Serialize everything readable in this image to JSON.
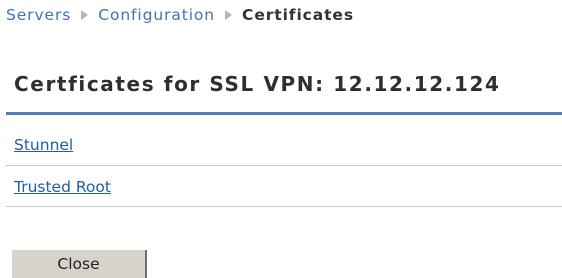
{
  "breadcrumb": {
    "items": [
      {
        "label": "Servers",
        "link": true
      },
      {
        "label": "Configuration",
        "link": true
      },
      {
        "label": "Certificates",
        "link": false
      }
    ]
  },
  "page": {
    "title": "Certficates for SSL VPN: 12.12.12.124"
  },
  "certificates": {
    "items": [
      {
        "label": "Stunnel"
      },
      {
        "label": "Trusted Root"
      }
    ]
  },
  "actions": {
    "close_label": "Close"
  },
  "icons": {
    "separator": "breadcrumb-arrow-icon"
  },
  "colors": {
    "link": "#1f5ea7",
    "breadcrumb_link": "#3e74b3",
    "title_rule": "#4a80b8",
    "button_bg": "#d6d3cc"
  }
}
